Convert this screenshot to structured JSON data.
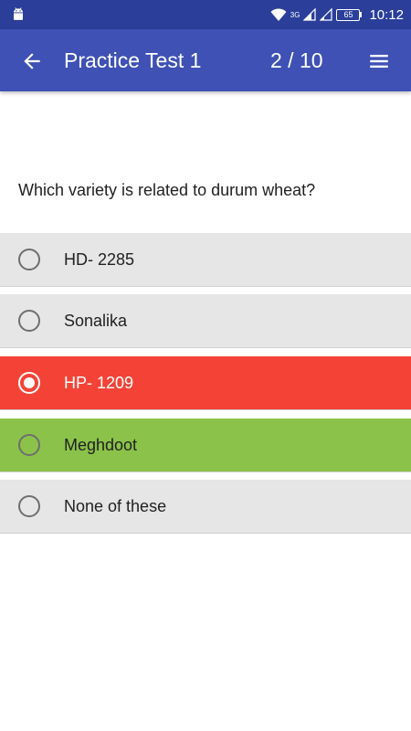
{
  "status_bar": {
    "network_label": "3G",
    "battery_level": "65",
    "time": "10:12"
  },
  "app_bar": {
    "title": "Practice Test 1",
    "current": "2",
    "separator": " / ",
    "total": "10"
  },
  "question": {
    "text": "Which variety is related to durum wheat?"
  },
  "options": [
    {
      "label": "HD- 2285",
      "state": "default",
      "color": "#e6e6e6"
    },
    {
      "label": "Sonalika",
      "state": "default",
      "color": "#e6e6e6"
    },
    {
      "label": "HP- 1209",
      "state": "selected-wrong",
      "color": "#f44336"
    },
    {
      "label": "Meghdoot",
      "state": "correct",
      "color": "#8bc34a"
    },
    {
      "label": "None of these",
      "state": "default",
      "color": "#e6e6e6"
    }
  ],
  "colors": {
    "status_bar": "#2a3e9a",
    "app_bar": "#3f51b5"
  },
  "icons": [
    "android-icon",
    "wifi-icon",
    "signal-icon",
    "battery-icon",
    "back-arrow-icon",
    "menu-icon",
    "radio-icon"
  ]
}
